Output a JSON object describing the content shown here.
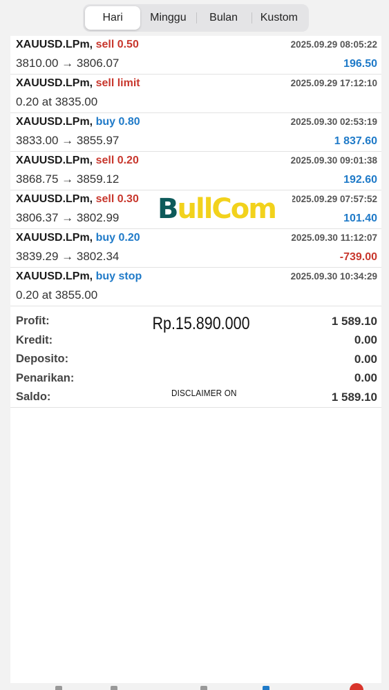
{
  "tabs": [
    {
      "label": "Hari",
      "active": true
    },
    {
      "label": "Minggu",
      "active": false
    },
    {
      "label": "Bulan",
      "active": false
    },
    {
      "label": "Kustom",
      "active": false
    }
  ],
  "trades": [
    {
      "symbol": "XAUUSD.LPm,",
      "side": "sell 0.50",
      "side_type": "sell",
      "time": "2025.09.29 08:05:22",
      "prices": "3810.00 → 3806.07",
      "profit": "196.50",
      "profit_sign": "pos"
    },
    {
      "symbol": "XAUUSD.LPm,",
      "side": "sell limit",
      "side_type": "sell",
      "time": "2025.09.29 17:12:10",
      "prices": "0.20 at 3835.00",
      "profit": "",
      "profit_sign": "pos"
    },
    {
      "symbol": "XAUUSD.LPm,",
      "side": "buy 0.80",
      "side_type": "buy",
      "time": "2025.09.30 02:53:19",
      "prices": "3833.00 → 3855.97",
      "profit": "1 837.60",
      "profit_sign": "pos"
    },
    {
      "symbol": "XAUUSD.LPm,",
      "side": "sell 0.20",
      "side_type": "sell",
      "time": "2025.09.30 09:01:38",
      "prices": "3868.75 → 3859.12",
      "profit": "192.60",
      "profit_sign": "pos"
    },
    {
      "symbol": "XAUUSD.LPm,",
      "side": "sell 0.30",
      "side_type": "sell",
      "time": "2025.09.29 07:57:52",
      "prices": "3806.37 → 3802.99",
      "profit": "101.40",
      "profit_sign": "pos"
    },
    {
      "symbol": "XAUUSD.LPm,",
      "side": "buy 0.20",
      "side_type": "buy",
      "time": "2025.09.30 11:12:07",
      "prices": "3839.29 → 3802.34",
      "profit": "-739.00",
      "profit_sign": "neg"
    },
    {
      "symbol": "XAUUSD.LPm,",
      "side": "buy stop",
      "side_type": "buy",
      "time": "2025.09.30 10:34:29",
      "prices": "0.20 at 3855.00",
      "profit": "",
      "profit_sign": "pos"
    }
  ],
  "summary": [
    {
      "label": "Profit:",
      "value": "1 589.10"
    },
    {
      "label": "Kredit:",
      "value": "0.00"
    },
    {
      "label": "Deposito:",
      "value": "0.00"
    },
    {
      "label": "Penarikan:",
      "value": "0.00"
    },
    {
      "label": "Saldo:",
      "value": "1 589.10"
    }
  ],
  "watermark": {
    "brand": "BullCom",
    "brand_first": "B",
    "brand_rest": "ullCom"
  },
  "overlay": {
    "amount": "Rp.15.890.000",
    "disclaimer": "DISCLAIMER ON"
  },
  "colors": {
    "sell": "#c8372d",
    "buy": "#1f7ac8",
    "brand_teal": "#0d5a5a",
    "brand_yellow": "#f2d21c"
  }
}
